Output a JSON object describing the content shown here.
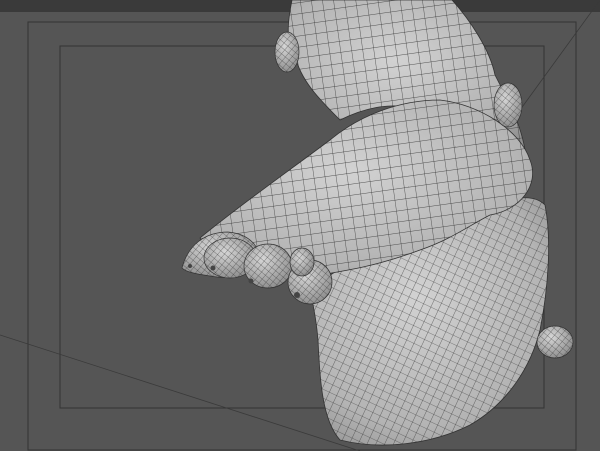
{
  "viewport": {
    "background": "#555555",
    "header_strip": "#3a3a3a",
    "safe_frame_color": "#2e2e2e",
    "mesh_fill": "#b9b9b9",
    "mesh_shadow": "#8a8a8a",
    "wire_color": "#2a2a2a"
  },
  "scene": {
    "model": "foot-mesh",
    "display_mode": "smooth-shade-with-wireframe"
  }
}
